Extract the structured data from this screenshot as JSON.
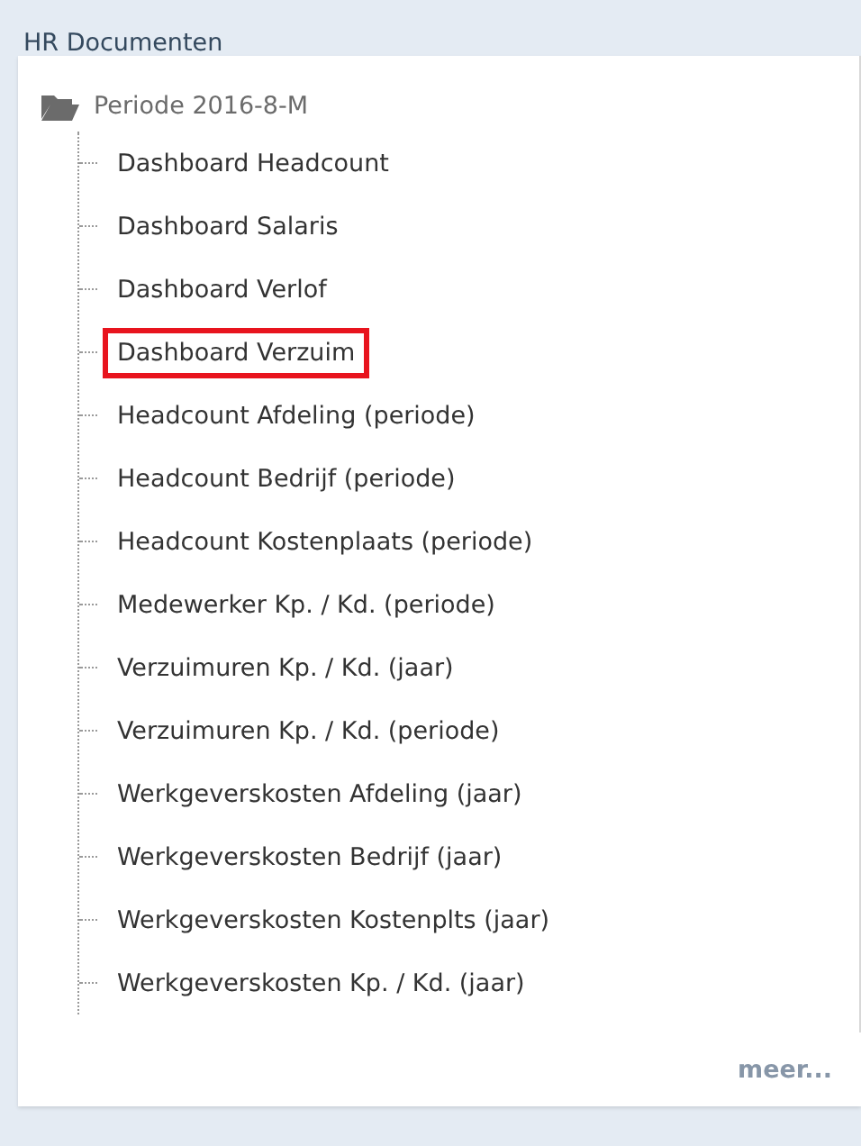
{
  "panel": {
    "title": "HR Documenten"
  },
  "tree": {
    "folder": {
      "label": "Periode 2016-8-M",
      "expanded": true
    },
    "items": [
      {
        "label": "Dashboard Headcount",
        "selected": false
      },
      {
        "label": "Dashboard Salaris",
        "selected": false
      },
      {
        "label": "Dashboard Verlof",
        "selected": false
      },
      {
        "label": "Dashboard Verzuim",
        "selected": true
      },
      {
        "label": "Headcount Afdeling (periode)",
        "selected": false
      },
      {
        "label": "Headcount Bedrijf (periode)",
        "selected": false
      },
      {
        "label": "Headcount Kostenplaats (periode)",
        "selected": false
      },
      {
        "label": "Medewerker Kp. / Kd. (periode)",
        "selected": false
      },
      {
        "label": "Verzuimuren Kp. / Kd. (jaar)",
        "selected": false
      },
      {
        "label": "Verzuimuren Kp. / Kd. (periode)",
        "selected": false
      },
      {
        "label": "Werkgeverskosten Afdeling (jaar)",
        "selected": false
      },
      {
        "label": "Werkgeverskosten Bedrijf (jaar)",
        "selected": false
      },
      {
        "label": "Werkgeverskosten Kostenplts (jaar)",
        "selected": false
      },
      {
        "label": "Werkgeverskosten Kp. / Kd. (jaar)",
        "selected": false
      }
    ]
  },
  "more_link": "meer..."
}
